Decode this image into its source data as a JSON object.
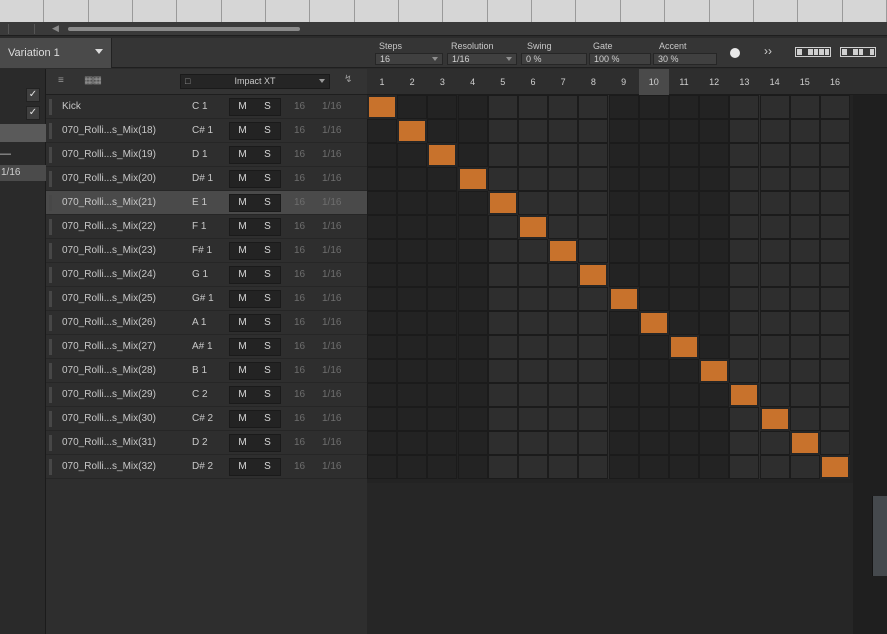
{
  "header": {
    "variation": "Variation 1",
    "params": [
      {
        "label": "Steps",
        "value": "16"
      },
      {
        "label": "Resolution",
        "value": "1/16"
      },
      {
        "label": "Swing",
        "value": "0 %"
      },
      {
        "label": "Gate",
        "value": "100 %"
      },
      {
        "label": "Accent",
        "value": "30 %"
      }
    ],
    "skip_label": "››"
  },
  "left_column": {
    "dash": "—",
    "resolution": "1/16"
  },
  "list": {
    "instrument": "Impact XT",
    "rows": [
      {
        "name": "Kick",
        "note": "C 1",
        "mute": "M",
        "solo": "S",
        "steps": "16",
        "res": "1/16"
      },
      {
        "name": "070_Rolli...s_Mix(18)",
        "note": "C# 1",
        "mute": "M",
        "solo": "S",
        "steps": "16",
        "res": "1/16"
      },
      {
        "name": "070_Rolli...s_Mix(19)",
        "note": "D 1",
        "mute": "M",
        "solo": "S",
        "steps": "16",
        "res": "1/16"
      },
      {
        "name": "070_Rolli...s_Mix(20)",
        "note": "D# 1",
        "mute": "M",
        "solo": "S",
        "steps": "16",
        "res": "1/16"
      },
      {
        "name": "070_Rolli...s_Mix(21)",
        "note": "E 1",
        "mute": "M",
        "solo": "S",
        "steps": "16",
        "res": "1/16"
      },
      {
        "name": "070_Rolli...s_Mix(22)",
        "note": "F 1",
        "mute": "M",
        "solo": "S",
        "steps": "16",
        "res": "1/16"
      },
      {
        "name": "070_Rolli...s_Mix(23)",
        "note": "F# 1",
        "mute": "M",
        "solo": "S",
        "steps": "16",
        "res": "1/16"
      },
      {
        "name": "070_Rolli...s_Mix(24)",
        "note": "G 1",
        "mute": "M",
        "solo": "S",
        "steps": "16",
        "res": "1/16"
      },
      {
        "name": "070_Rolli...s_Mix(25)",
        "note": "G# 1",
        "mute": "M",
        "solo": "S",
        "steps": "16",
        "res": "1/16"
      },
      {
        "name": "070_Rolli...s_Mix(26)",
        "note": "A 1",
        "mute": "M",
        "solo": "S",
        "steps": "16",
        "res": "1/16"
      },
      {
        "name": "070_Rolli...s_Mix(27)",
        "note": "A# 1",
        "mute": "M",
        "solo": "S",
        "steps": "16",
        "res": "1/16"
      },
      {
        "name": "070_Rolli...s_Mix(28)",
        "note": "B 1",
        "mute": "M",
        "solo": "S",
        "steps": "16",
        "res": "1/16"
      },
      {
        "name": "070_Rolli...s_Mix(29)",
        "note": "C 2",
        "mute": "M",
        "solo": "S",
        "steps": "16",
        "res": "1/16"
      },
      {
        "name": "070_Rolli...s_Mix(30)",
        "note": "C# 2",
        "mute": "M",
        "solo": "S",
        "steps": "16",
        "res": "1/16"
      },
      {
        "name": "070_Rolli...s_Mix(31)",
        "note": "D 2",
        "mute": "M",
        "solo": "S",
        "steps": "16",
        "res": "1/16"
      },
      {
        "name": "070_Rolli...s_Mix(32)",
        "note": "D# 2",
        "mute": "M",
        "solo": "S",
        "steps": "16",
        "res": "1/16"
      }
    ],
    "selected_row": 4
  },
  "grid": {
    "steps": [
      "1",
      "2",
      "3",
      "4",
      "5",
      "6",
      "7",
      "8",
      "9",
      "10",
      "11",
      "12",
      "13",
      "14",
      "15",
      "16"
    ],
    "current_step": 10,
    "active_steps_per_row": [
      1,
      2,
      3,
      4,
      5,
      6,
      7,
      8,
      9,
      10,
      11,
      12,
      13,
      14,
      15,
      16
    ],
    "step_color": "#c8722c"
  }
}
